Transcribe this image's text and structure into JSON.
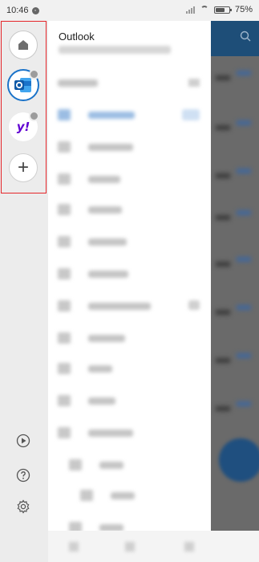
{
  "status_bar": {
    "time": "10:46",
    "battery": "75%",
    "battery_level": 0.75
  },
  "rail": {
    "accounts": [
      {
        "name": "home",
        "icon": "home-icon"
      },
      {
        "name": "outlook",
        "icon": "outlook-logo-icon"
      },
      {
        "name": "yahoo",
        "icon": "yahoo-logo-icon",
        "label": "y!"
      }
    ],
    "add_label": "+",
    "bottom_icons": [
      "play-circle-icon",
      "help-icon",
      "settings-gear-icon"
    ],
    "highlight_color": "#e5262a"
  },
  "drawer": {
    "title": "Outlook"
  },
  "colors": {
    "outlook_blue": "#1a73c9",
    "yahoo_purple": "#6001d2",
    "header_blue": "#1e4e78"
  }
}
